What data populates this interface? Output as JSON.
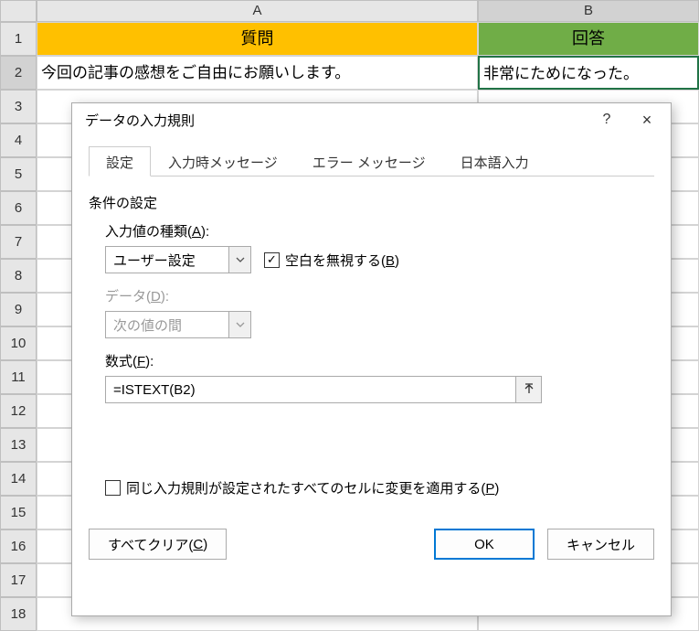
{
  "columns": [
    "A",
    "B"
  ],
  "rows": [
    "1",
    "2",
    "3",
    "4",
    "5",
    "6",
    "7",
    "8",
    "9",
    "10",
    "11",
    "12",
    "13",
    "14",
    "15",
    "16",
    "17",
    "18"
  ],
  "grid": {
    "a1": "質問",
    "b1": "回答",
    "a2": "今回の記事の感想をご自由にお願いします。",
    "b2": "非常にためになった。"
  },
  "dialog": {
    "title": "データの入力規則",
    "help": "?",
    "close": "×",
    "tabs": {
      "settings": "設定",
      "input_msg": "入力時メッセージ",
      "error_msg": "エラー メッセージ",
      "ime": "日本語入力"
    },
    "section": "条件の設定",
    "allow_label_prefix": "入力値の種類(",
    "allow_label_key": "A",
    "allow_label_suffix": "):",
    "allow_value": "ユーザー設定",
    "ignore_blank_prefix": "空白を無視する(",
    "ignore_blank_key": "B",
    "ignore_blank_suffix": ")",
    "ignore_blank_checked": "✓",
    "data_label_prefix": "データ(",
    "data_label_key": "D",
    "data_label_suffix": "):",
    "data_value": "次の値の間",
    "formula_label_prefix": "数式(",
    "formula_label_key": "F",
    "formula_label_suffix": "):",
    "formula_value": "=ISTEXT(B2)",
    "apply_all_prefix": "同じ入力規則が設定されたすべてのセルに変更を適用する(",
    "apply_all_key": "P",
    "apply_all_suffix": ")",
    "clear_prefix": "すべてクリア(",
    "clear_key": "C",
    "clear_suffix": ")",
    "ok": "OK",
    "cancel": "キャンセル"
  }
}
